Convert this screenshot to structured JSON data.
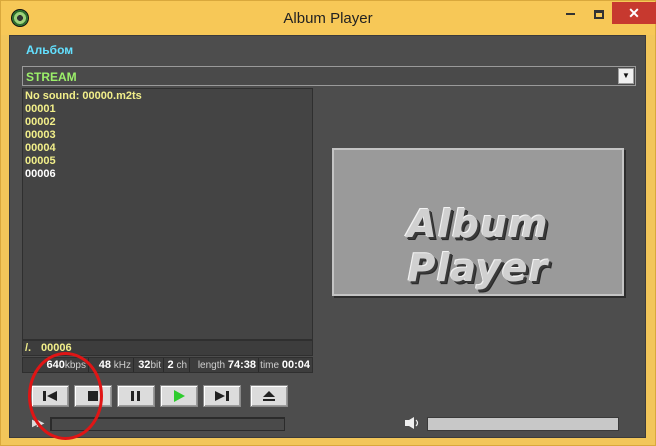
{
  "window": {
    "title": "Album Player",
    "close_glyph": "✕"
  },
  "album": {
    "label": "Альбом",
    "stream_value": "STREAM"
  },
  "playlist": {
    "items": [
      "No sound: 00000.m2ts",
      "00001",
      "00002",
      "00003",
      "00004",
      "00005",
      "00006"
    ],
    "current_index": 6
  },
  "now_playing": {
    "prefix": "/.",
    "track": "00006"
  },
  "info": {
    "bitrate": "640",
    "bitrate_unit": "kbps",
    "samplerate": "48",
    "samplerate_unit": "kHz",
    "bits": "32",
    "bits_unit": "bit",
    "channels": "2",
    "channels_unit": "ch",
    "length_label": "length",
    "length": "74:38",
    "time_label": "time",
    "time": "00:04"
  },
  "controls": {
    "buttons": [
      "previous",
      "stop",
      "pause",
      "play",
      "next",
      "eject"
    ]
  },
  "progress": {
    "value": 0
  },
  "volume": {
    "value": 1.0
  },
  "cover": {
    "text": "Album Player"
  },
  "colors": {
    "accent_label": "#63e0ff",
    "stream_text": "#9cf06a",
    "playlist_text": "#f2ef8a",
    "play_green": "#2ecc2e",
    "annotation_red": "#e01515"
  }
}
